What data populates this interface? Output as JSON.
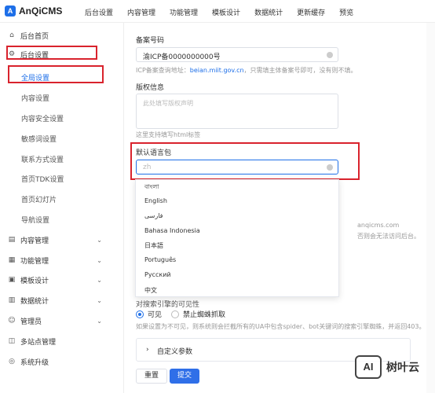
{
  "app": {
    "logo_letter": "A",
    "name": "AnQiCMS"
  },
  "topnav": [
    "后台设置",
    "内容管理",
    "功能管理",
    "模板设计",
    "数据统计",
    "更新缓存",
    "预览"
  ],
  "sidebar": {
    "items": [
      {
        "label": "后台首页",
        "icon": "home-icon"
      },
      {
        "label": "后台设置",
        "icon": "gear-icon"
      },
      {
        "label": "内容管理",
        "icon": "document-icon"
      },
      {
        "label": "功能管理",
        "icon": "grid-icon"
      },
      {
        "label": "模板设计",
        "icon": "template-icon"
      },
      {
        "label": "数据统计",
        "icon": "chart-icon"
      },
      {
        "label": "管理员",
        "icon": "user-icon"
      },
      {
        "label": "多站点管理",
        "icon": "sites-icon"
      },
      {
        "label": "系统升级",
        "icon": "upgrade-icon"
      }
    ],
    "sub_items": [
      "全局设置",
      "内容设置",
      "内容安全设置",
      "敏感词设置",
      "联系方式设置",
      "首页TDK设置",
      "首页幻灯片",
      "导航设置"
    ]
  },
  "form": {
    "icp_label": "备案号码",
    "icp_value": "渝ICP备0000000000号",
    "icp_help_prefix": "ICP备案查询地址：",
    "icp_help_link": "beian.miit.gov.cn",
    "icp_help_suffix": "，只需填主体备案号即可，没有则不填。",
    "copyright_label": "版权信息",
    "copyright_placeholder": "此处填写版权声明",
    "copyright_help": "这里支持填写html标签",
    "lang_label": "默认语言包",
    "lang_value": "zh",
    "lang_options": [
      "বাংলা",
      "English",
      "فارسی",
      "Bahasa Indonesia",
      "日本語",
      "Português",
      "Русский",
      "中文"
    ],
    "bg_text_1": "anqicms.com",
    "bg_text_2": "否则会无法访问后台。",
    "spider_label": "对搜索引擎的可见性",
    "radio_visible": "可见",
    "radio_block": "禁止蜘蛛抓取",
    "spider_help": "如果设置为不可见，则系统则会拦截所有的UA中包含spider、bot关键词的搜索引擎蜘蛛，并返回403。",
    "custom_params": "自定义参数",
    "reset": "重置",
    "submit": "提交"
  },
  "watermark": {
    "badge": "AI",
    "text": "树叶云"
  },
  "colors": {
    "accent": "#1e6fe8",
    "highlight": "#d9232d"
  }
}
